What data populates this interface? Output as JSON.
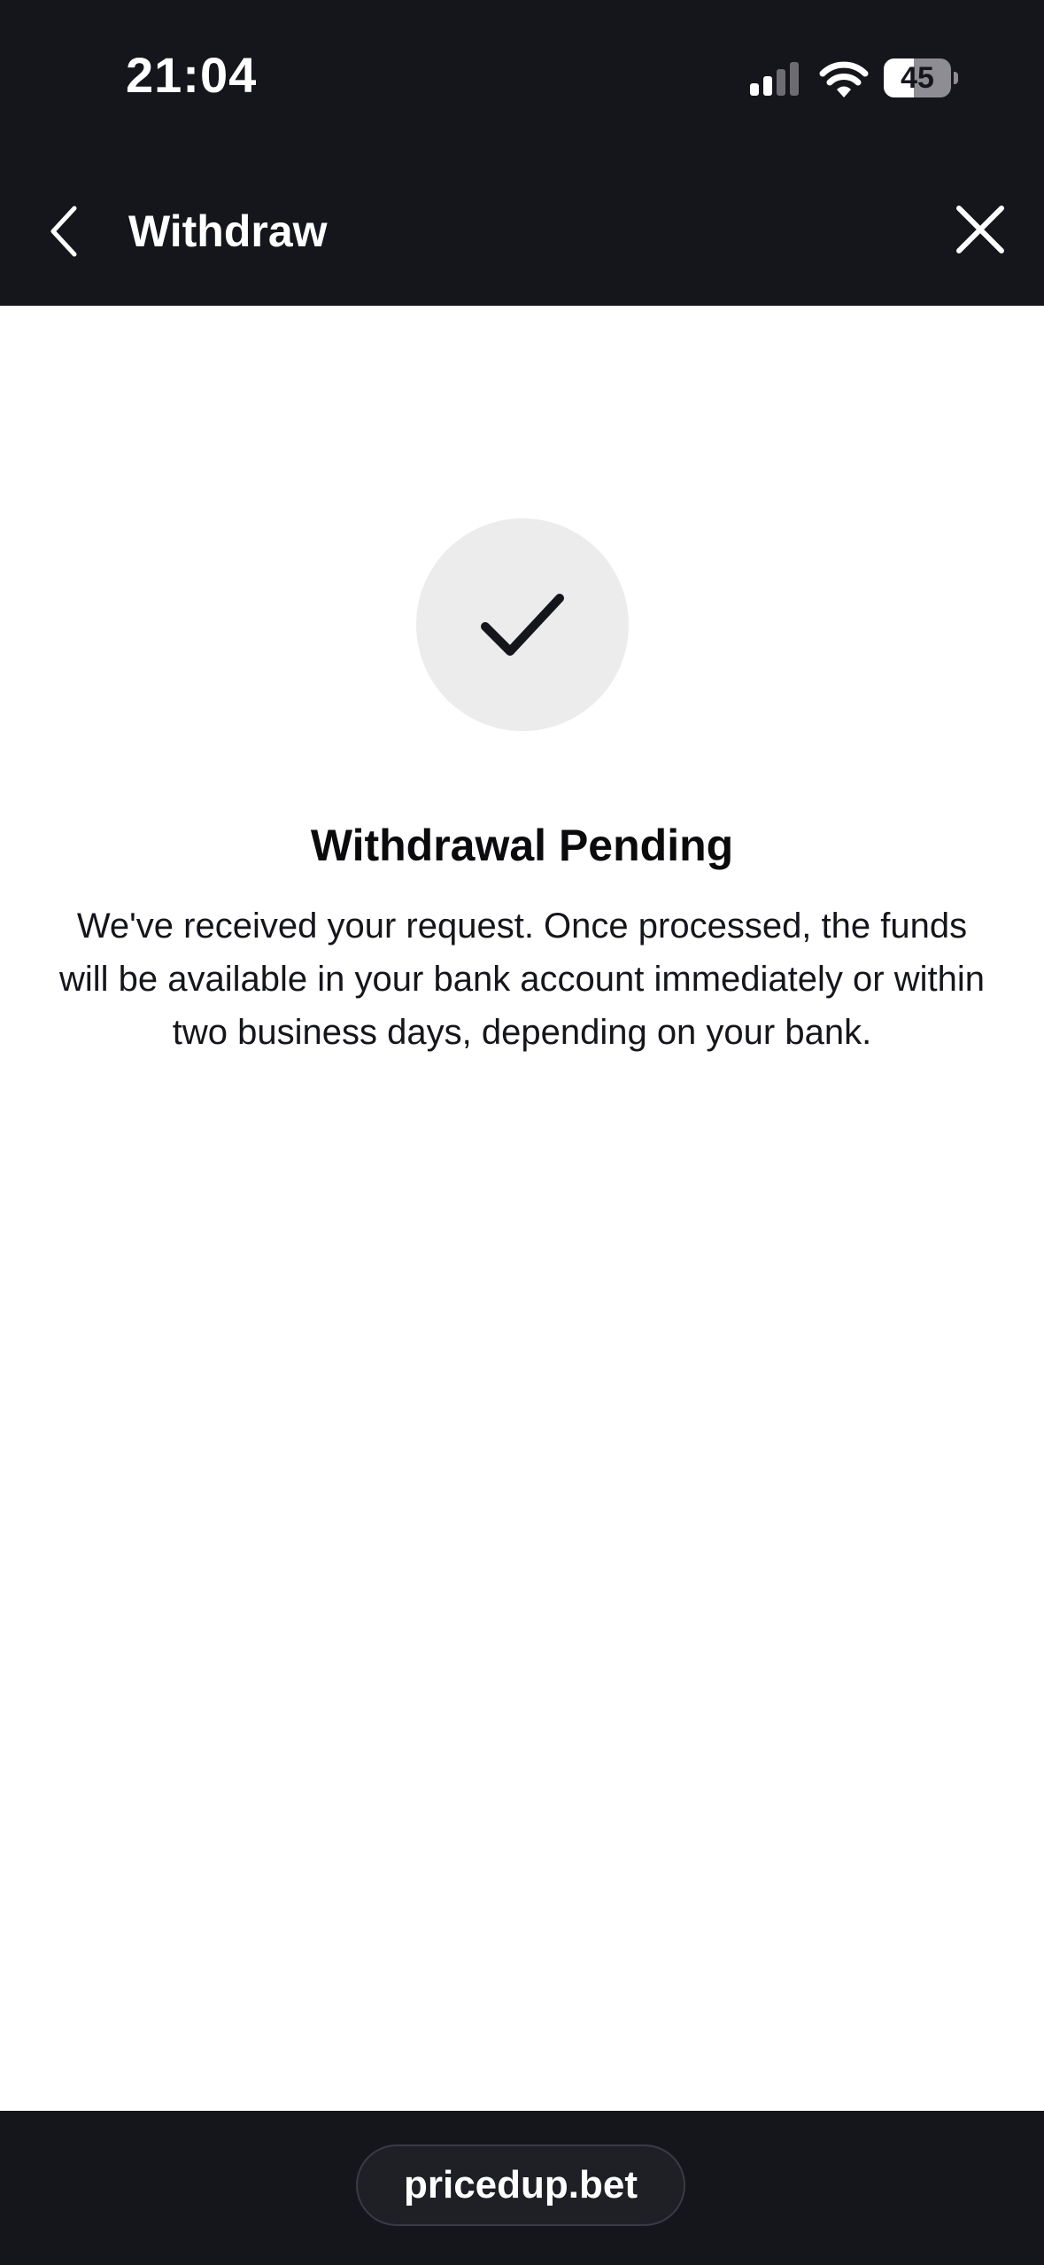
{
  "status_bar": {
    "time": "21:04",
    "battery_level": "45",
    "icons": [
      "signal-icon",
      "wifi-icon",
      "battery-icon"
    ]
  },
  "nav": {
    "title": "Withdraw",
    "back_icon": "chevron-left-icon",
    "close_icon": "close-icon"
  },
  "content": {
    "status_icon": "checkmark-icon",
    "title": "Withdrawal Pending",
    "message": "We've received your request. Once processed, the funds will be available in your bank account immediately or within two business days, depending on your bank."
  },
  "browser": {
    "url": "pricedup.bet"
  },
  "colors": {
    "header_bg": "#15161b",
    "page_bg": "#ffffff",
    "icon_circle_bg": "#ececec",
    "text_dark": "#0b0b0d"
  }
}
